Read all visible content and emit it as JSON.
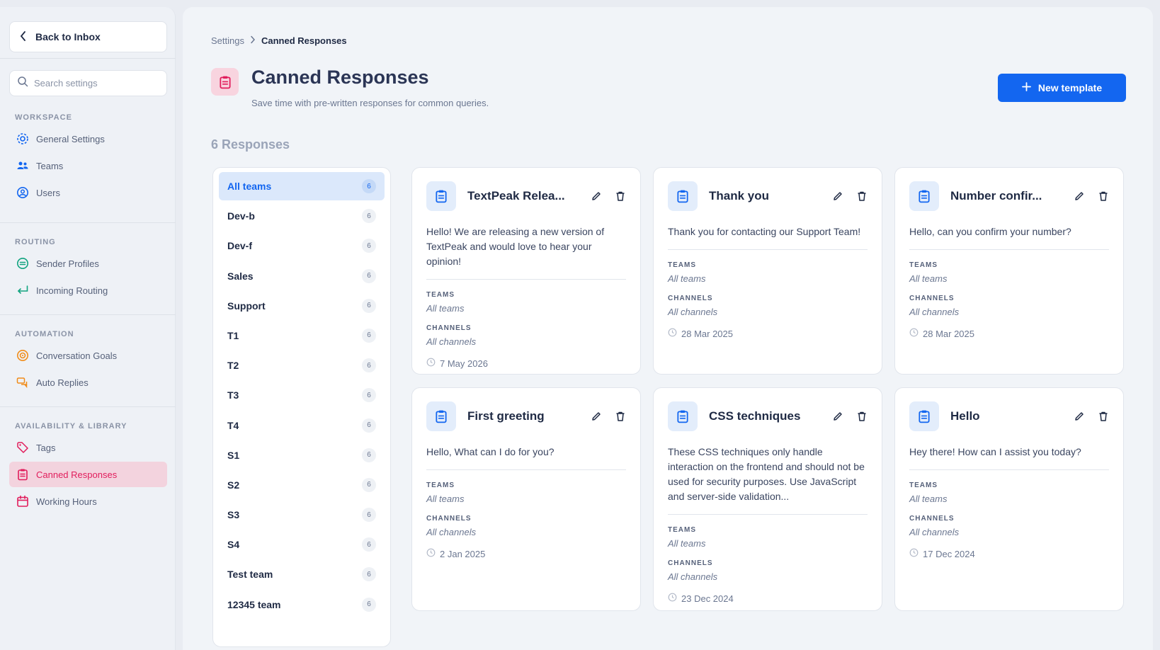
{
  "sidebar": {
    "back_label": "Back to Inbox",
    "search_placeholder": "Search settings",
    "sections": {
      "workspace": "WORKSPACE",
      "routing": "ROUTING",
      "automation": "AUTOMATION",
      "library": "AVAILABILITY & LIBRARY"
    },
    "items": {
      "general": "General Settings",
      "teams": "Teams",
      "users": "Users",
      "sender": "Sender Profiles",
      "incoming": "Incoming Routing",
      "goals": "Conversation Goals",
      "auto": "Auto Replies",
      "tags": "Tags",
      "canned": "Canned Responses",
      "hours": "Working Hours"
    }
  },
  "header": {
    "breadcrumb_parent": "Settings",
    "breadcrumb_current": "Canned Responses",
    "title": "Canned Responses",
    "subtitle": "Save time with pre-written responses for common queries.",
    "new_button": "New template",
    "count": "6 Responses"
  },
  "teams": [
    {
      "name": "All teams",
      "count": "6"
    },
    {
      "name": "Dev-b",
      "count": "6"
    },
    {
      "name": "Dev-f",
      "count": "6"
    },
    {
      "name": "Sales",
      "count": "6"
    },
    {
      "name": "Support",
      "count": "6"
    },
    {
      "name": "T1",
      "count": "6"
    },
    {
      "name": "T2",
      "count": "6"
    },
    {
      "name": "T3",
      "count": "6"
    },
    {
      "name": "T4",
      "count": "6"
    },
    {
      "name": "S1",
      "count": "6"
    },
    {
      "name": "S2",
      "count": "6"
    },
    {
      "name": "S3",
      "count": "6"
    },
    {
      "name": "S4",
      "count": "6"
    },
    {
      "name": "Test team",
      "count": "6"
    },
    {
      "name": "12345 team",
      "count": "6"
    }
  ],
  "labels": {
    "teams": "TEAMS",
    "channels": "CHANNELS"
  },
  "cards": [
    {
      "title": "TextPeak Relea...",
      "body": "Hello! We are releasing a new version of TextPeak and would love to hear your opinion!",
      "teams": "All teams",
      "channels": "All channels",
      "date": "7 May 2026"
    },
    {
      "title": "Thank you",
      "body": "Thank you for contacting our Support Team!",
      "teams": "All teams",
      "channels": "All channels",
      "date": "28 Mar 2025"
    },
    {
      "title": "Number confir...",
      "body": "Hello, can you confirm your number?",
      "teams": "All teams",
      "channels": "All channels",
      "date": "28 Mar 2025"
    },
    {
      "title": "First greeting",
      "body": "Hello, What can I do for you?",
      "teams": "All teams",
      "channels": "All channels",
      "date": "2 Jan 2025"
    },
    {
      "title": "CSS techniques",
      "body": "These CSS techniques only handle interaction on the frontend and should not be used for security purposes. Use JavaScript and server-side validation...",
      "teams": "All teams",
      "channels": "All channels",
      "date": "23 Dec 2024"
    },
    {
      "title": "Hello",
      "body": "Hey there! How can I assist you today?",
      "teams": "All teams",
      "channels": "All channels",
      "date": "17 Dec 2024"
    }
  ],
  "colors": {
    "accent": "#1366f0",
    "brand_pink": "#e11d5c"
  }
}
